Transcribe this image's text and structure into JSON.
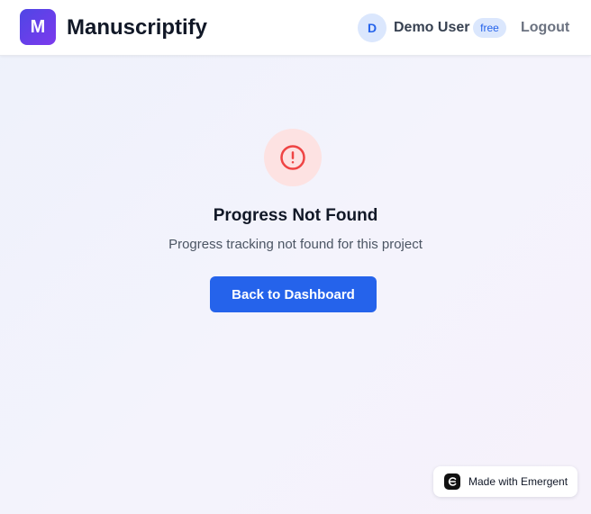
{
  "header": {
    "logo_letter": "M",
    "app_name": "Manuscriptify",
    "user": {
      "avatar_initial": "D",
      "name": "Demo User",
      "plan": "free"
    },
    "logout_label": "Logout"
  },
  "main": {
    "icon": "alert-circle-icon",
    "title": "Progress Not Found",
    "message": "Progress tracking not found for this project",
    "button_label": "Back to Dashboard"
  },
  "badge": {
    "label": "Made with Emergent",
    "icon": "emergent-logo-icon"
  },
  "colors": {
    "accent": "#2563eb",
    "logo_gradient_start": "#4f46e5",
    "logo_gradient_end": "#7c3aed",
    "error": "#ef4444",
    "error_bg": "#fde2e2"
  }
}
